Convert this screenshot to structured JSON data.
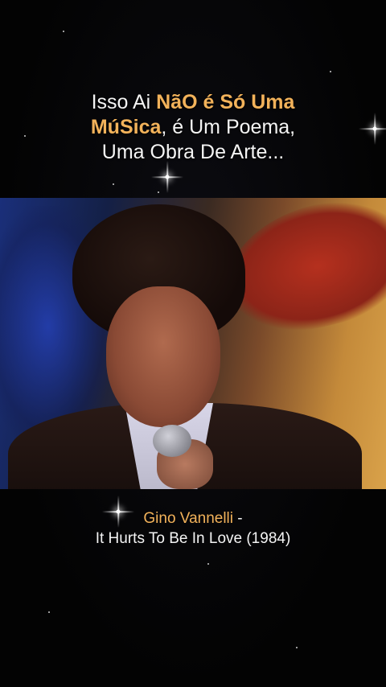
{
  "headline": {
    "line1_plain": "Isso Ai ",
    "line1_highlight": "NãO é Só Uma",
    "line2_highlight": "MúSica",
    "line2_plain": ", é Um Poema,",
    "line3": "Uma Obra De Arte..."
  },
  "caption": {
    "artist": "Gino Vannelli",
    "separator": " -",
    "song": "It Hurts To Be In Love (1984)"
  },
  "colors": {
    "highlight": "#f2b25a",
    "background": "#050505",
    "text": "#f4f4f4"
  }
}
